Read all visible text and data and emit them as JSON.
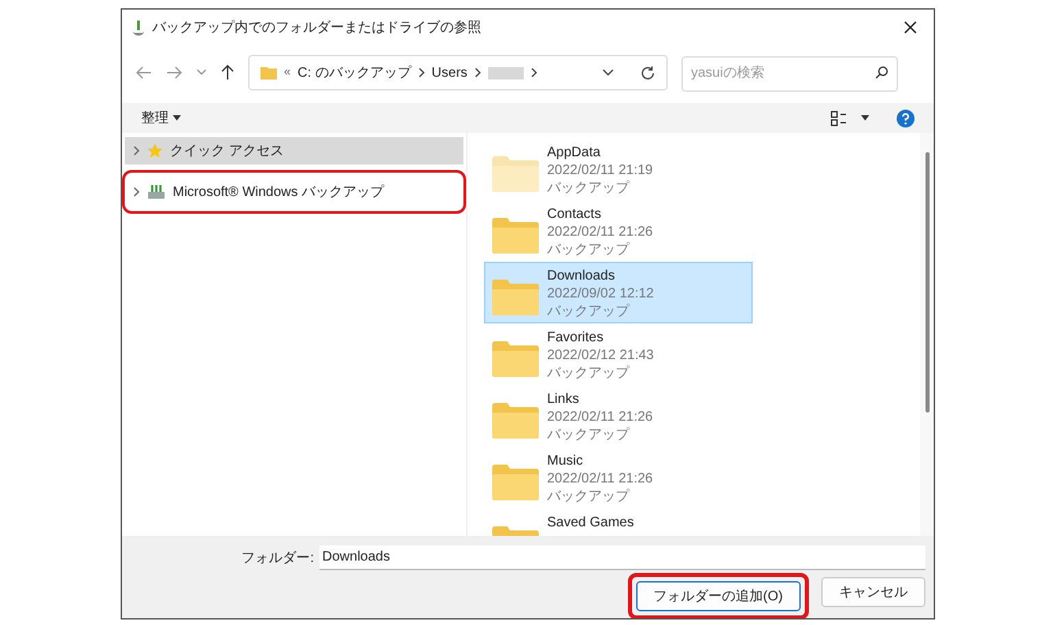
{
  "window": {
    "title": "バックアップ内でのフォルダーまたはドライブの参照"
  },
  "address": {
    "prefix": "«",
    "crumbs": [
      "C: のバックアップ",
      "Users"
    ]
  },
  "search": {
    "placeholder": "yasuiの検索"
  },
  "toolbar": {
    "organize": "整理"
  },
  "tree": [
    {
      "label": "クイック アクセス",
      "kind": "star",
      "selected": true,
      "highlighted": false
    },
    {
      "label": "Microsoft® Windows バックアップ",
      "kind": "backup",
      "selected": false,
      "highlighted": true
    }
  ],
  "files": [
    {
      "name": "AppData",
      "date": "2022/02/11 21:19",
      "type": "バックアップ",
      "selected": false,
      "hidden": true
    },
    {
      "name": "Contacts",
      "date": "2022/02/11 21:26",
      "type": "バックアップ",
      "selected": false,
      "hidden": false
    },
    {
      "name": "Downloads",
      "date": "2022/09/02 12:12",
      "type": "バックアップ",
      "selected": true,
      "hidden": false
    },
    {
      "name": "Favorites",
      "date": "2022/02/12 21:43",
      "type": "バックアップ",
      "selected": false,
      "hidden": false
    },
    {
      "name": "Links",
      "date": "2022/02/11 21:26",
      "type": "バックアップ",
      "selected": false,
      "hidden": false
    },
    {
      "name": "Music",
      "date": "2022/02/11 21:26",
      "type": "バックアップ",
      "selected": false,
      "hidden": false
    },
    {
      "name": "Saved Games",
      "selected": false,
      "hidden": false
    }
  ],
  "footer": {
    "folder_label": "フォルダー:",
    "folder_value": "Downloads",
    "buttons": [
      {
        "label": "フォルダーの追加(O)",
        "default": true,
        "highlighted": true
      },
      {
        "label": "キャンセル",
        "default": false,
        "highlighted": false
      }
    ]
  }
}
